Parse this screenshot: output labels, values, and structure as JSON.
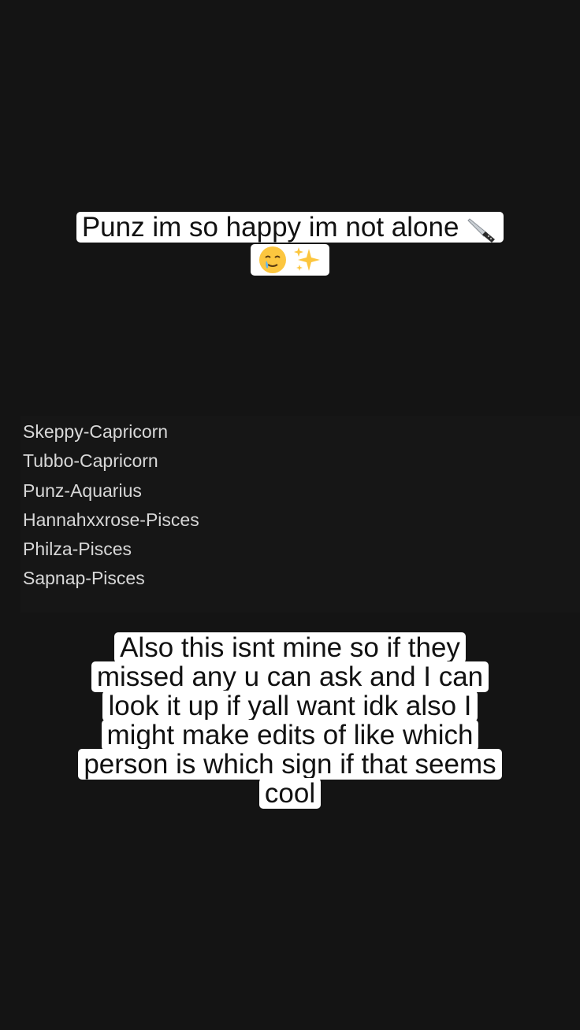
{
  "top_caption": {
    "line1": "Punz im so happy im not alone",
    "icons": [
      "knife-icon",
      "smiling-face-with-tear-icon",
      "sparkles-icon"
    ]
  },
  "zodiac_list": {
    "items": [
      "Skeppy-Capricorn",
      "Tubbo-Capricorn",
      "Punz-Aquarius",
      "Hannahxxrose-Pisces",
      "Philza-Pisces",
      "Sapnap-Pisces"
    ]
  },
  "bottom_caption": {
    "lines": [
      "Also this isnt mine so if they",
      "missed any u can ask and I can",
      "look it up if yall want idk also I",
      "might make edits of like which",
      "person is which sign if that seems",
      "cool"
    ]
  },
  "colors": {
    "background": "#141414",
    "caption_bg": "#ffffff",
    "caption_text": "#111111",
    "list_text": "#d8d8d8"
  }
}
